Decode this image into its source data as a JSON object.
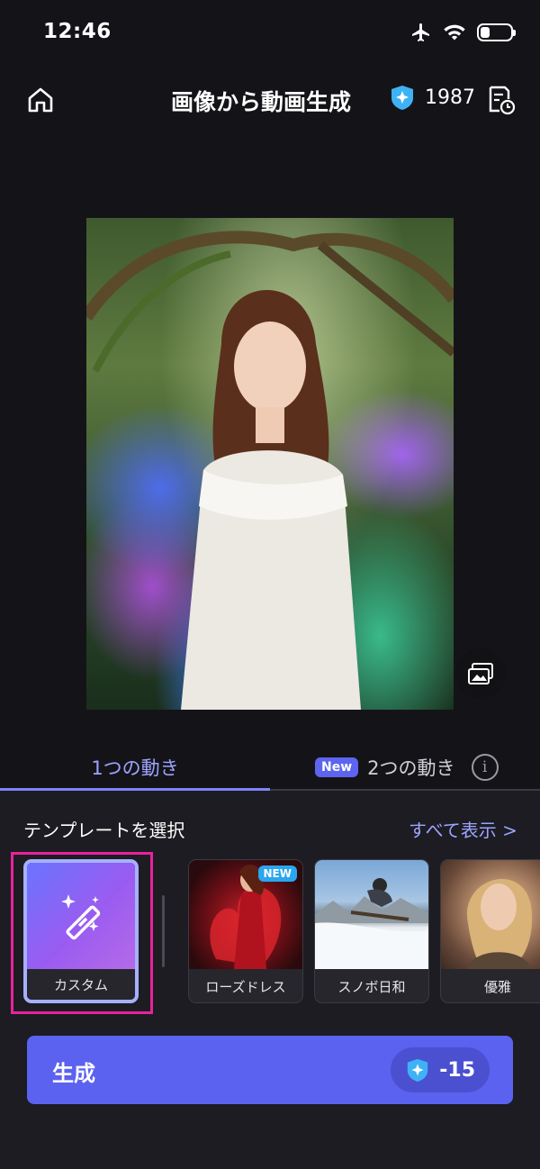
{
  "status_bar": {
    "time": "12:46",
    "battery_level": 0.3
  },
  "header": {
    "title": "画像から動画生成",
    "credits": "1987"
  },
  "tabs": {
    "one_motion": "1つの動き",
    "two_motion_badge": "New",
    "two_motion": "2つの動き"
  },
  "templates": {
    "section_title": "テンプレートを選択",
    "see_all": "すべて表示 >",
    "items": [
      {
        "label": "カスタム",
        "icon": "magic-wand-icon",
        "selected": true
      },
      {
        "label": "ローズドレス",
        "badge": "NEW"
      },
      {
        "label": "スノボ日和"
      },
      {
        "label": "優雅"
      }
    ]
  },
  "generate": {
    "label": "生成",
    "cost": "-15"
  },
  "colors": {
    "accent": "#5b62f0",
    "selection": "#e8229e",
    "badge_blue": "#2aa6ef",
    "credit_gem": "#3fb2f5"
  },
  "icons": [
    "home-icon",
    "credit-gem-icon",
    "history-icon",
    "airplane-icon",
    "wifi-icon",
    "battery-icon",
    "swap-image-icon",
    "info-icon",
    "magic-wand-icon"
  ]
}
